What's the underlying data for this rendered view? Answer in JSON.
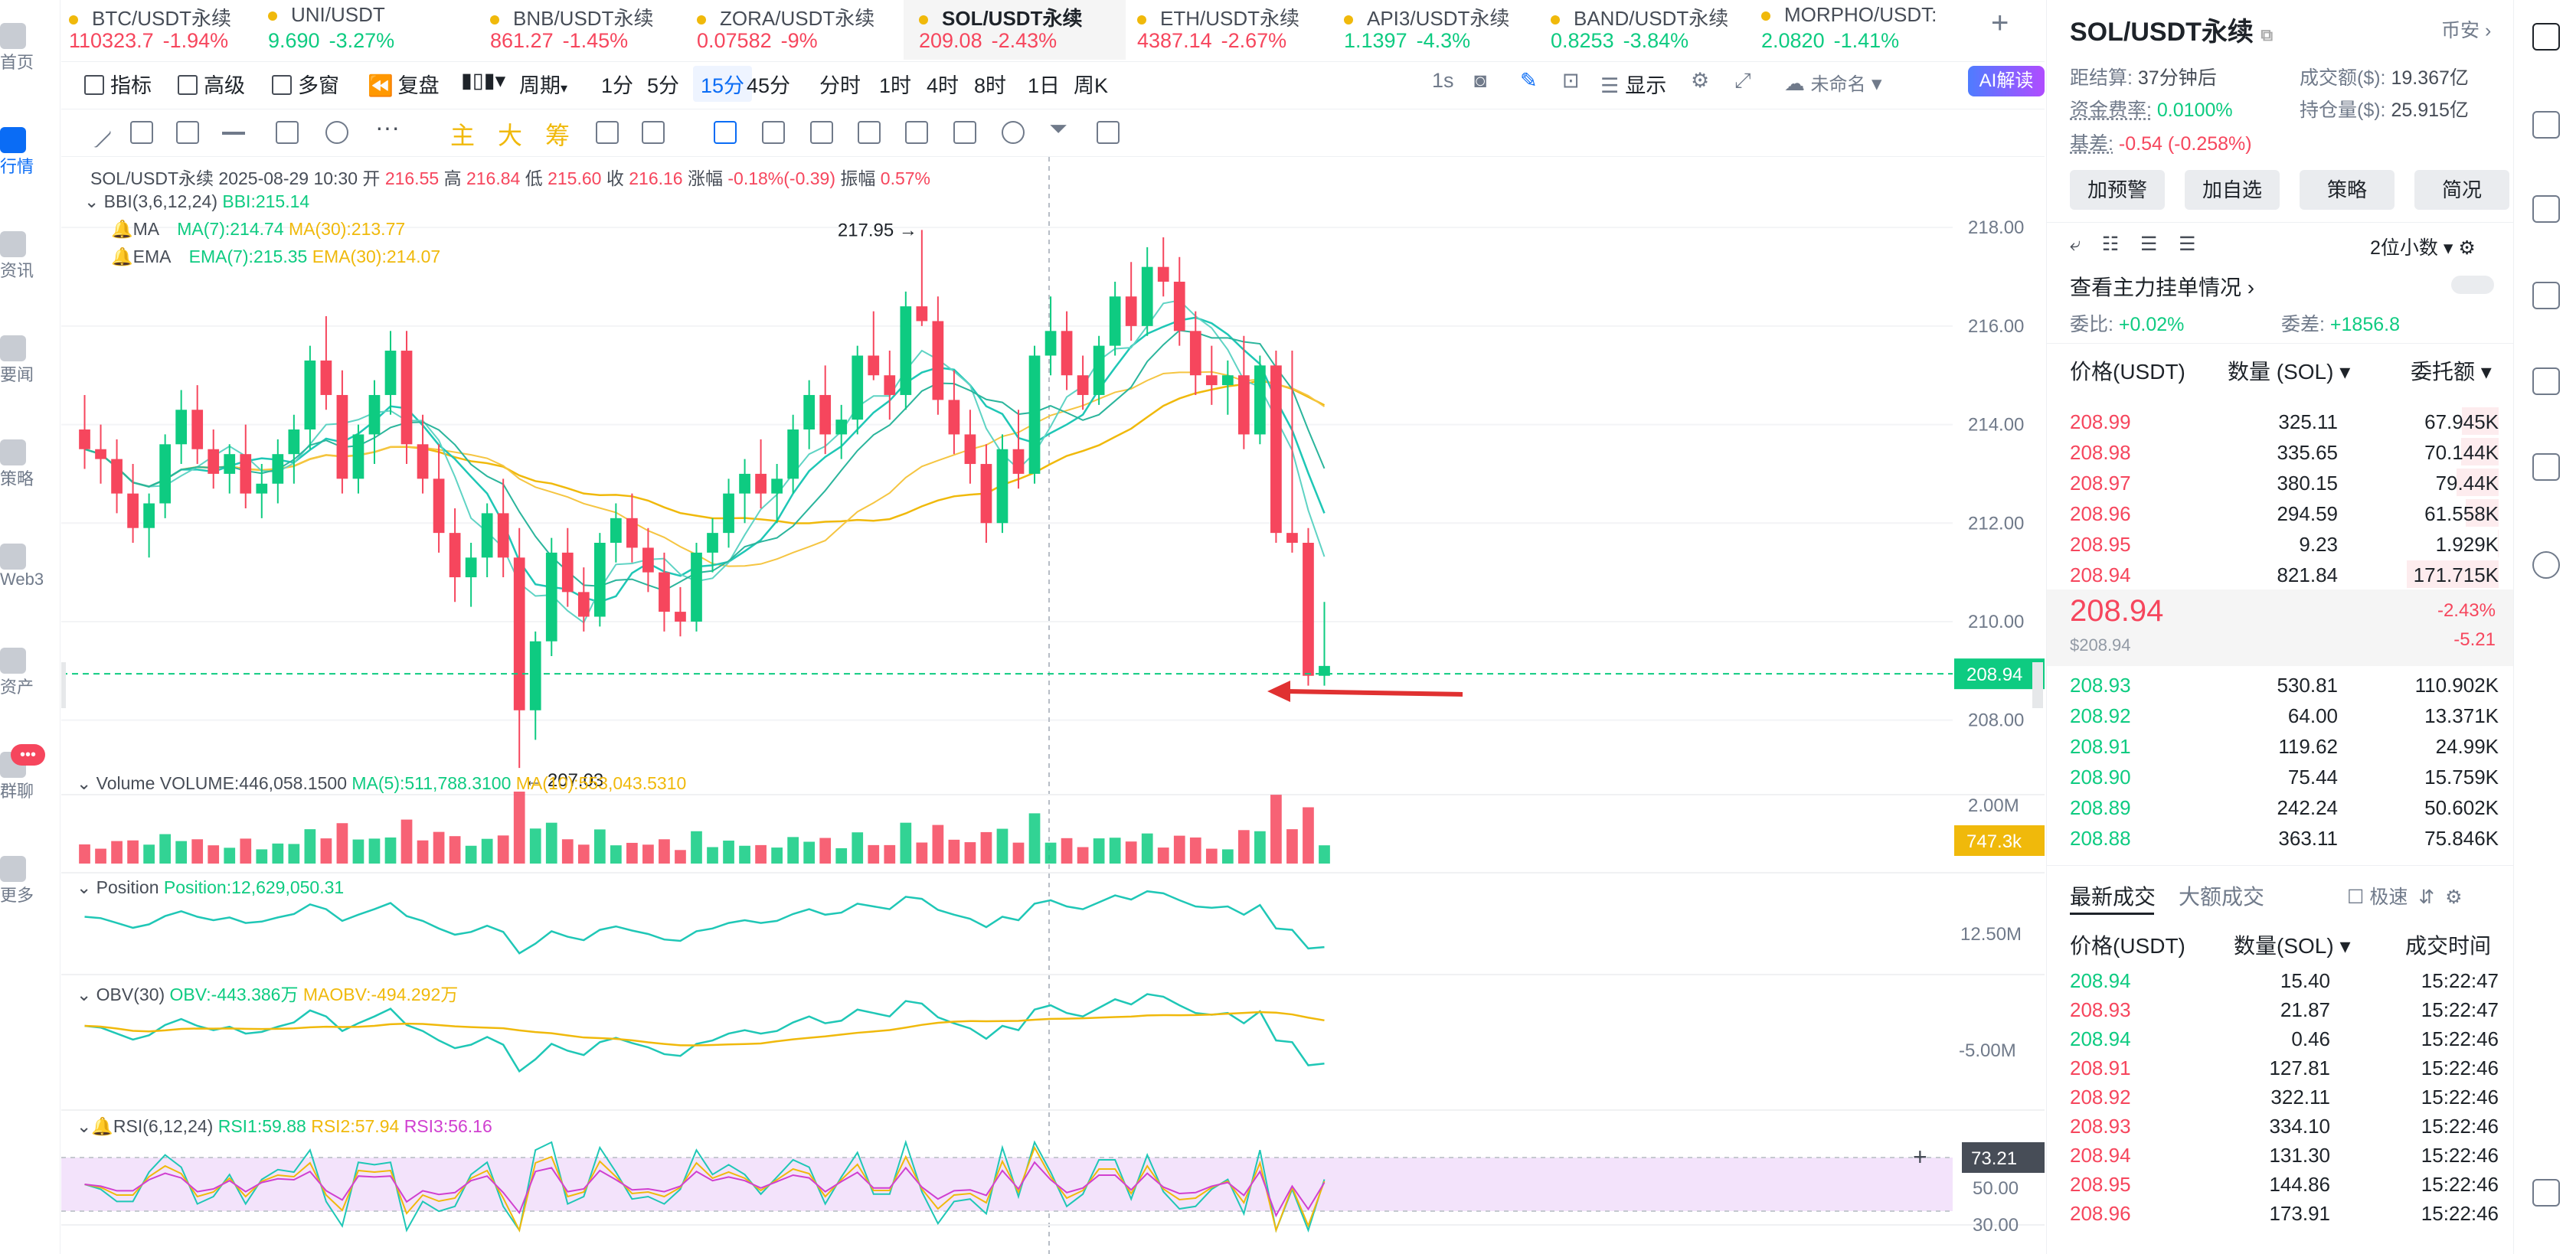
{
  "left_nav": [
    {
      "label": "首页",
      "icon": "home-icon"
    },
    {
      "label": "行情",
      "icon": "market-icon",
      "active": true
    },
    {
      "label": "资讯",
      "icon": "news-icon"
    },
    {
      "label": "要闻",
      "icon": "headline-icon"
    },
    {
      "label": "策略",
      "icon": "strategy-icon"
    },
    {
      "label": "Web3",
      "icon": "web3-icon"
    },
    {
      "label": "资产",
      "icon": "wallet-icon"
    },
    {
      "label": "群聊",
      "icon": "chat-icon",
      "badge": "•••"
    },
    {
      "label": "更多",
      "icon": "more-icon"
    }
  ],
  "tickers": [
    {
      "name": "BTC/USDT永续",
      "price": "110323.7",
      "change": "-1.94%",
      "dir": "dn"
    },
    {
      "name": "UNI/USDT",
      "price": "9.690",
      "change": "-3.27%",
      "dir": "up"
    },
    {
      "name": "BNB/USDT永续",
      "price": "861.27",
      "change": "-1.45%",
      "dir": "dn"
    },
    {
      "name": "ZORA/USDT永续",
      "price": "0.07582",
      "change": "-9%",
      "dir": "dn"
    },
    {
      "name": "SOL/USDT永续",
      "price": "209.08",
      "change": "-2.43%",
      "dir": "dn",
      "active": true
    },
    {
      "name": "ETH/USDT永续",
      "price": "4387.14",
      "change": "-2.67%",
      "dir": "dn"
    },
    {
      "name": "API3/USDT永续",
      "price": "1.1397",
      "change": "-4.3%",
      "dir": "up"
    },
    {
      "name": "BAND/USDT永续",
      "price": "0.8253",
      "change": "-3.84%",
      "dir": "up"
    },
    {
      "name": "MORPHO/USDT:",
      "price": "2.0820",
      "change": "-1.41%",
      "dir": "up"
    }
  ],
  "add_tab": "+",
  "toolbar": {
    "indicators": "指标",
    "advanced": "高级",
    "multi": "多窗",
    "replay": "复盘",
    "period": "周期",
    "intervals": [
      "1分",
      "5分",
      "15分",
      "45分",
      "分时",
      "1时",
      "4时",
      "8时",
      "1日",
      "周K"
    ],
    "selected_interval": "15分",
    "one_s": "1s",
    "display": "显示",
    "unnamed": "未命名",
    "ai": "AI解读"
  },
  "draw_tools": {
    "main": "主",
    "big": "大",
    "chip": "筹"
  },
  "overlay": {
    "symbol": "SOL/USDT永续",
    "datetime": "2025-08-29 10:30",
    "open_label": "开",
    "open": "216.55",
    "high_label": "高",
    "high": "216.84",
    "low_label": "低",
    "low": "215.60",
    "close_label": "收",
    "close": "216.16",
    "change_label": "涨幅",
    "change": "-0.18%(-0.39)",
    "amp_label": "振幅",
    "amp": "0.57%",
    "bbi_label": "BBI(3,6,12,24)",
    "bbi_value": "BBI:215.14",
    "ma_label": "MA",
    "ma7": "MA(7):214.74",
    "ma30": "MA(30):213.77",
    "ema_label": "EMA",
    "ema7": "EMA(7):215.35",
    "ema30": "EMA(30):214.07",
    "volume_label": "Volume",
    "volume_value": "VOLUME:446,058.1500",
    "vol_ma5": "MA(5):511,788.3100",
    "vol_ma10": "MA(10):553,043.5310",
    "position_label": "Position",
    "position_value": "Position:12,629,050.31",
    "obv_label": "OBV(30)",
    "obv_value": "OBV:-443.386万",
    "maobv_value": "MAOBV:-494.292万",
    "rsi_label": "RSI(6,12,24)",
    "rsi1": "RSI1:59.88",
    "rsi2": "RSI2:57.94",
    "rsi3": "RSI3:56.16"
  },
  "chart_data": {
    "type": "candlestick",
    "interval": "15m",
    "y_axis": {
      "min": 207.0,
      "max": 218.5,
      "ticks": [
        "218.00",
        "216.00",
        "214.00",
        "212.00",
        "210.00",
        "208.00"
      ]
    },
    "current_price": "208.94",
    "annotations": {
      "high": "217.95",
      "low": "207.03"
    },
    "candles_ohlc": [
      [
        213.9,
        214.6,
        213.1,
        213.5
      ],
      [
        213.5,
        214.0,
        212.8,
        213.3
      ],
      [
        213.3,
        213.7,
        212.2,
        212.6
      ],
      [
        212.6,
        213.2,
        211.6,
        211.9
      ],
      [
        211.9,
        212.6,
        211.3,
        212.4
      ],
      [
        212.4,
        213.8,
        212.1,
        213.6
      ],
      [
        213.6,
        214.7,
        213.2,
        214.3
      ],
      [
        214.3,
        214.8,
        213.2,
        213.5
      ],
      [
        213.5,
        213.9,
        212.7,
        213.0
      ],
      [
        213.0,
        213.6,
        212.6,
        213.4
      ],
      [
        213.4,
        214.0,
        212.3,
        212.6
      ],
      [
        212.6,
        213.2,
        212.1,
        212.8
      ],
      [
        212.8,
        213.7,
        212.4,
        213.4
      ],
      [
        213.4,
        214.2,
        212.8,
        213.9
      ],
      [
        213.9,
        215.6,
        213.5,
        215.3
      ],
      [
        215.3,
        216.2,
        214.3,
        214.6
      ],
      [
        214.6,
        215.1,
        212.6,
        212.9
      ],
      [
        212.9,
        214.0,
        212.6,
        213.8
      ],
      [
        213.8,
        214.9,
        213.2,
        214.6
      ],
      [
        214.6,
        215.9,
        214.2,
        215.5
      ],
      [
        215.5,
        215.9,
        213.2,
        213.6
      ],
      [
        213.6,
        214.2,
        212.6,
        212.9
      ],
      [
        212.9,
        213.6,
        211.4,
        211.8
      ],
      [
        211.8,
        212.3,
        210.4,
        210.9
      ],
      [
        210.9,
        211.6,
        210.3,
        211.3
      ],
      [
        211.3,
        212.4,
        210.9,
        212.2
      ],
      [
        212.2,
        212.9,
        210.9,
        211.3
      ],
      [
        211.3,
        211.9,
        207.03,
        208.2
      ],
      [
        208.2,
        209.8,
        207.6,
        209.6
      ],
      [
        209.6,
        211.7,
        209.3,
        211.4
      ],
      [
        211.4,
        211.9,
        210.3,
        210.6
      ],
      [
        210.6,
        211.1,
        209.8,
        210.1
      ],
      [
        210.1,
        211.8,
        209.9,
        211.6
      ],
      [
        211.6,
        212.4,
        211.2,
        212.1
      ],
      [
        212.1,
        212.6,
        211.2,
        211.5
      ],
      [
        211.5,
        211.9,
        210.6,
        211.0
      ],
      [
        211.0,
        211.4,
        209.8,
        210.2
      ],
      [
        210.2,
        210.7,
        209.7,
        210.0
      ],
      [
        210.0,
        211.6,
        209.8,
        211.4
      ],
      [
        211.4,
        212.1,
        211.0,
        211.8
      ],
      [
        211.8,
        212.9,
        211.5,
        212.6
      ],
      [
        212.6,
        213.3,
        212.0,
        213.0
      ],
      [
        213.0,
        213.7,
        212.3,
        212.6
      ],
      [
        212.6,
        213.2,
        212.0,
        212.9
      ],
      [
        212.9,
        214.2,
        212.6,
        213.9
      ],
      [
        213.9,
        214.9,
        213.5,
        214.6
      ],
      [
        214.6,
        215.2,
        213.4,
        213.8
      ],
      [
        213.8,
        214.4,
        213.3,
        214.1
      ],
      [
        214.1,
        215.6,
        213.8,
        215.4
      ],
      [
        215.4,
        216.3,
        214.9,
        215.0
      ],
      [
        215.0,
        215.5,
        214.1,
        214.6
      ],
      [
        214.6,
        216.7,
        214.3,
        216.4
      ],
      [
        216.4,
        217.95,
        216.0,
        216.1
      ],
      [
        216.1,
        216.6,
        214.2,
        214.5
      ],
      [
        214.5,
        215.1,
        213.4,
        213.8
      ],
      [
        213.8,
        214.3,
        212.8,
        213.2
      ],
      [
        213.2,
        213.6,
        211.6,
        212.0
      ],
      [
        212.0,
        213.8,
        211.8,
        213.5
      ],
      [
        213.5,
        214.3,
        212.7,
        213.0
      ],
      [
        213.0,
        215.6,
        212.8,
        215.4
      ],
      [
        215.4,
        216.6,
        215.0,
        215.9
      ],
      [
        215.9,
        216.3,
        214.7,
        215.0
      ],
      [
        215.0,
        215.4,
        214.3,
        214.6
      ],
      [
        214.6,
        215.8,
        214.4,
        215.6
      ],
      [
        215.6,
        216.9,
        215.4,
        216.6
      ],
      [
        216.6,
        217.3,
        215.7,
        216.0
      ],
      [
        216.0,
        217.6,
        215.8,
        217.2
      ],
      [
        217.2,
        217.8,
        216.6,
        216.9
      ],
      [
        216.9,
        217.4,
        215.6,
        215.9
      ],
      [
        215.9,
        216.3,
        214.6,
        215.0
      ],
      [
        215.0,
        215.6,
        214.4,
        214.8
      ],
      [
        214.8,
        215.3,
        214.2,
        215.0
      ],
      [
        215.0,
        215.8,
        213.5,
        213.8
      ],
      [
        213.8,
        215.4,
        213.6,
        215.2
      ],
      [
        215.2,
        215.5,
        211.6,
        211.8
      ],
      [
        211.8,
        215.5,
        211.4,
        211.6
      ],
      [
        211.6,
        211.9,
        208.7,
        208.9
      ],
      [
        208.9,
        210.4,
        208.7,
        209.1
      ]
    ],
    "volume_axis": {
      "label": "2.00M",
      "current": "747.3k"
    },
    "position_axis": {
      "label": "12.50M"
    },
    "obv_axis": {
      "label": "-5.00M"
    },
    "rsi_axis": {
      "ticks": [
        "50.00",
        "30.00"
      ],
      "current": "73.21"
    }
  },
  "right": {
    "symbol": "SOL/USDT永续",
    "exchange": "币安",
    "settle_label": "距结算:",
    "settle": "37分钟后",
    "turnover_label": "成交额($):",
    "turnover": "19.367亿",
    "funding_label": "资金费率:",
    "funding": "0.0100%",
    "oi_label": "持仓量($):",
    "oi": "25.915亿",
    "basis_label": "基差:",
    "basis": "-0.54 (-0.258%)",
    "buttons": [
      "加预警",
      "加自选",
      "策略",
      "简况"
    ],
    "decimals": "2位小数",
    "main_orders": "查看主力挂单情况",
    "ratio_label": "委比:",
    "ratio": "+0.02%",
    "diff_label": "委差:",
    "diff": "+1856.8",
    "ob_headers": [
      "价格(USDT)",
      "数量 (SOL)",
      "委托额"
    ],
    "asks": [
      [
        "208.99",
        "325.11",
        "67.945K"
      ],
      [
        "208.98",
        "335.65",
        "70.144K"
      ],
      [
        "208.97",
        "380.15",
        "79.44K"
      ],
      [
        "208.96",
        "294.59",
        "61.558K"
      ],
      [
        "208.95",
        "9.23",
        "1.929K"
      ],
      [
        "208.94",
        "821.84",
        "171.715K"
      ]
    ],
    "last_price": "208.94",
    "last_usd": "$208.94",
    "last_pct": "-2.43%",
    "last_chg": "-5.21",
    "bids": [
      [
        "208.93",
        "530.81",
        "110.902K"
      ],
      [
        "208.92",
        "64.00",
        "13.371K"
      ],
      [
        "208.91",
        "119.62",
        "24.99K"
      ],
      [
        "208.90",
        "75.44",
        "15.759K"
      ],
      [
        "208.89",
        "242.24",
        "50.602K"
      ],
      [
        "208.88",
        "363.11",
        "75.846K"
      ]
    ],
    "trades_tab1": "最新成交",
    "trades_tab2": "大额成交",
    "fast_label": "极速",
    "trade_headers": [
      "价格(USDT)",
      "数量(SOL)",
      "成交时间"
    ],
    "trades": [
      [
        "208.94",
        "15.40",
        "15:22:47",
        "up"
      ],
      [
        "208.93",
        "21.87",
        "15:22:47",
        "dn"
      ],
      [
        "208.94",
        "0.46",
        "15:22:46",
        "up"
      ],
      [
        "208.91",
        "127.81",
        "15:22:46",
        "dn"
      ],
      [
        "208.92",
        "322.11",
        "15:22:46",
        "dn"
      ],
      [
        "208.93",
        "334.10",
        "15:22:46",
        "dn"
      ],
      [
        "208.94",
        "131.30",
        "15:22:46",
        "dn"
      ],
      [
        "208.95",
        "144.86",
        "15:22:46",
        "dn"
      ],
      [
        "208.96",
        "173.91",
        "15:22:46",
        "dn"
      ]
    ]
  },
  "colors": {
    "up": "#0ecb81",
    "down": "#f6465d",
    "accent": "#0a6cf5",
    "ma_fast": "#1fc7b6",
    "ma_slow": "#f0b90b",
    "rsi3": "#d040d0"
  }
}
